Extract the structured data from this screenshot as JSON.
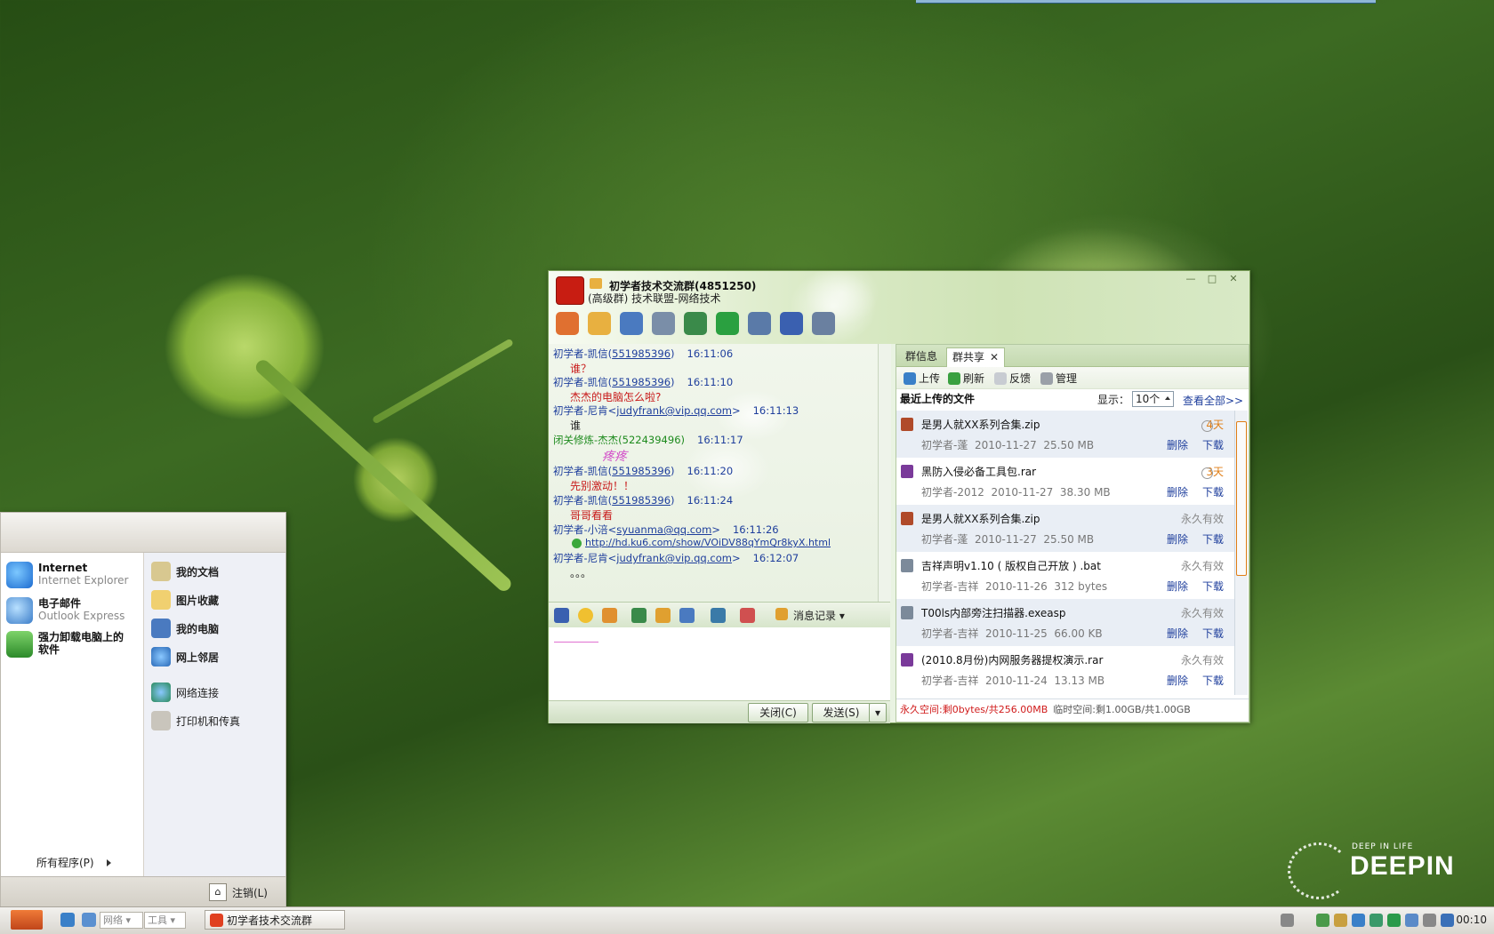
{
  "start_menu": {
    "pinned": [
      {
        "title": "Internet",
        "sub": "Internet Explorer"
      },
      {
        "title": "电子邮件",
        "sub": "Outlook Express"
      },
      {
        "title": "强力卸载电脑上的\n软件",
        "sub": ""
      }
    ],
    "places": [
      "我的文档",
      "图片收藏",
      "我的电脑",
      "网上邻居",
      "网络连接",
      "打印机和传真"
    ],
    "all_programs": "所有程序(P)",
    "logoff": "注销(L)"
  },
  "qq": {
    "title": "初学者技术交流群(4851250)",
    "subtitle": "(高级群) 技术联盟-网络技术",
    "window_buttons": [
      "—",
      "□",
      "✕"
    ],
    "messages": [
      {
        "sender": "初学者-凯信",
        "id": "551985396",
        "time": "16:11:06",
        "text": "谁？",
        "color": "red"
      },
      {
        "sender": "初学者-凯信",
        "id": "551985396",
        "time": "16:11:10",
        "text": "杰杰的电脑怎么啦?",
        "color": "red"
      },
      {
        "sender": "初学者-尼肯",
        "id": "judyfrank@vip.qq.com",
        "time": "16:11:13",
        "text": "谁",
        "color": "black"
      },
      {
        "sender": "闭关修炼-杰杰",
        "id": "522439496",
        "time": "16:11:17",
        "text": "疼疼",
        "color": "pink"
      },
      {
        "sender": "初学者-凯信",
        "id": "551985396",
        "time": "16:11:20",
        "text": "先别激动！！",
        "color": "red"
      },
      {
        "sender": "初学者-凯信",
        "id": "551985396",
        "time": "16:11:24",
        "text": "哥哥看看",
        "color": "red"
      },
      {
        "sender": "初学者-小涪",
        "id": "syuanma@qq.com",
        "time": "16:11:26",
        "text": "http://hd.ku6.com/show/VOiDV88qYmQr8kyX.html",
        "color": "link"
      },
      {
        "sender": "初学者-尼肯",
        "id": "judyfrank@vip.qq.com",
        "time": "16:12:07",
        "text": "。。。",
        "color": "black"
      }
    ],
    "history_label": "消息记录",
    "close_button": "关闭(C)",
    "send_button": "发送(S)"
  },
  "share": {
    "tabs": [
      "群信息",
      "群共享"
    ],
    "tab_close": "✕",
    "toolbar": [
      "上传",
      "刷新",
      "反馈",
      "管理"
    ],
    "recent_label": "最近上传的文件",
    "show_label": "显示：",
    "show_value": "10个",
    "view_all": "查看全部>>",
    "delete_label": "删除",
    "download_label": "下载",
    "files": [
      {
        "name": "是男人就XX系列合集.zip",
        "uploader": "初学者-蓬",
        "date": "2010-11-27",
        "size": "25.50 MB",
        "expiry": "4天",
        "icon_color": "#b04a2a"
      },
      {
        "name": "黑防入侵必备工具包.rar",
        "uploader": "初学者-2012",
        "date": "2010-11-27",
        "size": "38.30 MB",
        "expiry": "3天",
        "icon_color": "#7a3a9a"
      },
      {
        "name": "是男人就XX系列合集.zip",
        "uploader": "初学者-蓬",
        "date": "2010-11-27",
        "size": "25.50 MB",
        "expiry": "永久有效",
        "icon_color": "#b04a2a"
      },
      {
        "name": "吉祥声明v1.10 ( 版权自己开放 ) .bat",
        "uploader": "初学者-吉祥",
        "date": "2010-11-26",
        "size": "312 bytes",
        "expiry": "永久有效",
        "icon_color": "#7c8a9a"
      },
      {
        "name": "T00ls内部旁注扫描器.exeasp",
        "uploader": "初学者-吉祥",
        "date": "2010-11-25",
        "size": "66.00 KB",
        "expiry": "永久有效",
        "icon_color": "#7c8a9a"
      },
      {
        "name": "(2010.8月份)内网服务器提权演示.rar",
        "uploader": "初学者-吉祥",
        "date": "2010-11-24",
        "size": "13.13 MB",
        "expiry": "永久有效",
        "icon_color": "#7a3a9a"
      }
    ],
    "quota_permanent": "永久空间:剩0bytes/共256.00MB",
    "quota_temp": "临时空间:剩1.00GB/共1.00GB"
  },
  "taskbar": {
    "select1": "网络",
    "select2": "工具",
    "task": "初学者技术交流群",
    "clock": "00:10"
  },
  "wallpaper": {
    "tagline": "DEEP IN LIFE",
    "brand": "DEEPIN"
  }
}
